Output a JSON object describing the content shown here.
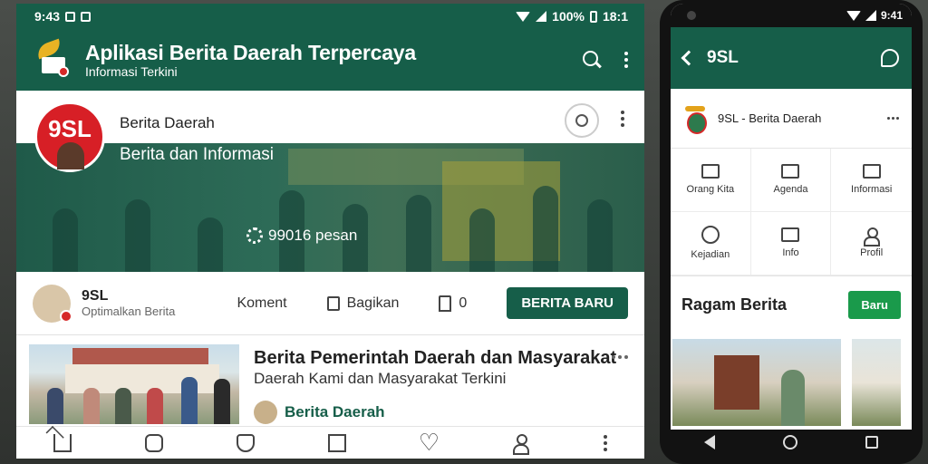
{
  "tablet": {
    "status": {
      "time": "9:43",
      "battery": "100%",
      "clock_right": "18:1"
    },
    "appbar": {
      "title": "Aplikasi Berita Daerah Terpercaya",
      "subtitle": "Informasi Terkini"
    },
    "profile": {
      "avatar_text": "9SL",
      "name": "Berita Daerah",
      "tagline": "Berita dan Informasi",
      "stat": "99016 pesan"
    },
    "action_row": {
      "name": "9SL",
      "sub": "Optimalkan Berita",
      "items": [
        "Koment",
        "Bagikan",
        "0"
      ],
      "button": "BERITA BARU"
    },
    "news": {
      "title": "Berita Pemerintah Daerah dan Masyarakat",
      "description": "Daerah Kami dan Masyarakat Terkini",
      "source": "Berita Daerah"
    },
    "bottom_nav": [
      "home-icon",
      "chat-icon",
      "shield-icon",
      "document-icon",
      "heart-icon",
      "user-icon",
      "more-icon"
    ]
  },
  "phone": {
    "status": {
      "time": "9:41"
    },
    "appbar": {
      "title": "9SL"
    },
    "profile": {
      "name": "9SL - Berita Daerah"
    },
    "grid": [
      {
        "icon": "mail-icon",
        "label": "Orang Kita"
      },
      {
        "icon": "calendar-icon",
        "label": "Agenda"
      },
      {
        "icon": "mail-icon",
        "label": "Informasi"
      },
      {
        "icon": "clock-icon",
        "label": "Kejadian"
      },
      {
        "icon": "message-icon",
        "label": "Info"
      },
      {
        "icon": "user-icon",
        "label": "Profil"
      }
    ],
    "section": {
      "heading": "Ragam Berita",
      "button": "Baru"
    }
  },
  "colors": {
    "brand": "#165e49",
    "accent": "#1a9a4b",
    "badge": "#d62828"
  }
}
